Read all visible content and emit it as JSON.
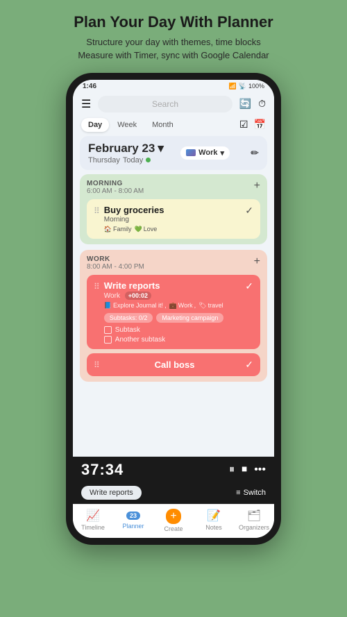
{
  "app": {
    "header_title": "Plan Your Day With Planner",
    "header_subtitle_line1": "Structure your day with themes, time blocks",
    "header_subtitle_line2": "Measure with Timer, sync with Google Calendar"
  },
  "status_bar": {
    "time": "1:46",
    "battery": "100%",
    "signal": "●●●"
  },
  "search": {
    "placeholder": "Search"
  },
  "tabs": {
    "day": "Day",
    "week": "Week",
    "month": "Month",
    "active": "Day"
  },
  "date_header": {
    "date": "February 23",
    "day_name": "Thursday",
    "today_label": "Today",
    "theme": "Work"
  },
  "sections": {
    "morning": {
      "label": "MORNING",
      "time": "6:00 AM - 8:00 AM",
      "tasks": [
        {
          "title": "Buy groceries",
          "subtitle": "Morning",
          "tags": [
            "Family",
            "Love"
          ],
          "checked": true
        }
      ]
    },
    "work": {
      "label": "WORK",
      "time": "8:00 AM - 4:00 PM",
      "tasks": [
        {
          "title": "Write reports",
          "subtitle": "Work",
          "timer": "+00:02",
          "tags": [
            "Explore Journal it!",
            "Work",
            "travel"
          ],
          "subtask_chips": [
            "Subtasks: 0/2",
            "Marketing campaign"
          ],
          "subtasks": [
            "Subtask",
            "Another subtask"
          ],
          "checked": true
        },
        {
          "title": "Call boss",
          "checked": true
        }
      ]
    }
  },
  "timer": {
    "time": "37:34",
    "active_task": "Write reports"
  },
  "bottom_nav": {
    "items": [
      {
        "label": "Timeline",
        "icon": "📈",
        "active": false
      },
      {
        "label": "Planner",
        "icon": "📅",
        "active": true,
        "badge": "23"
      },
      {
        "label": "Create",
        "icon": "➕",
        "active": false,
        "special": true
      },
      {
        "label": "Notes",
        "icon": "📝",
        "active": false
      },
      {
        "label": "Organizers",
        "icon": "🗂",
        "active": false
      }
    ],
    "switch_label": "Switch"
  }
}
